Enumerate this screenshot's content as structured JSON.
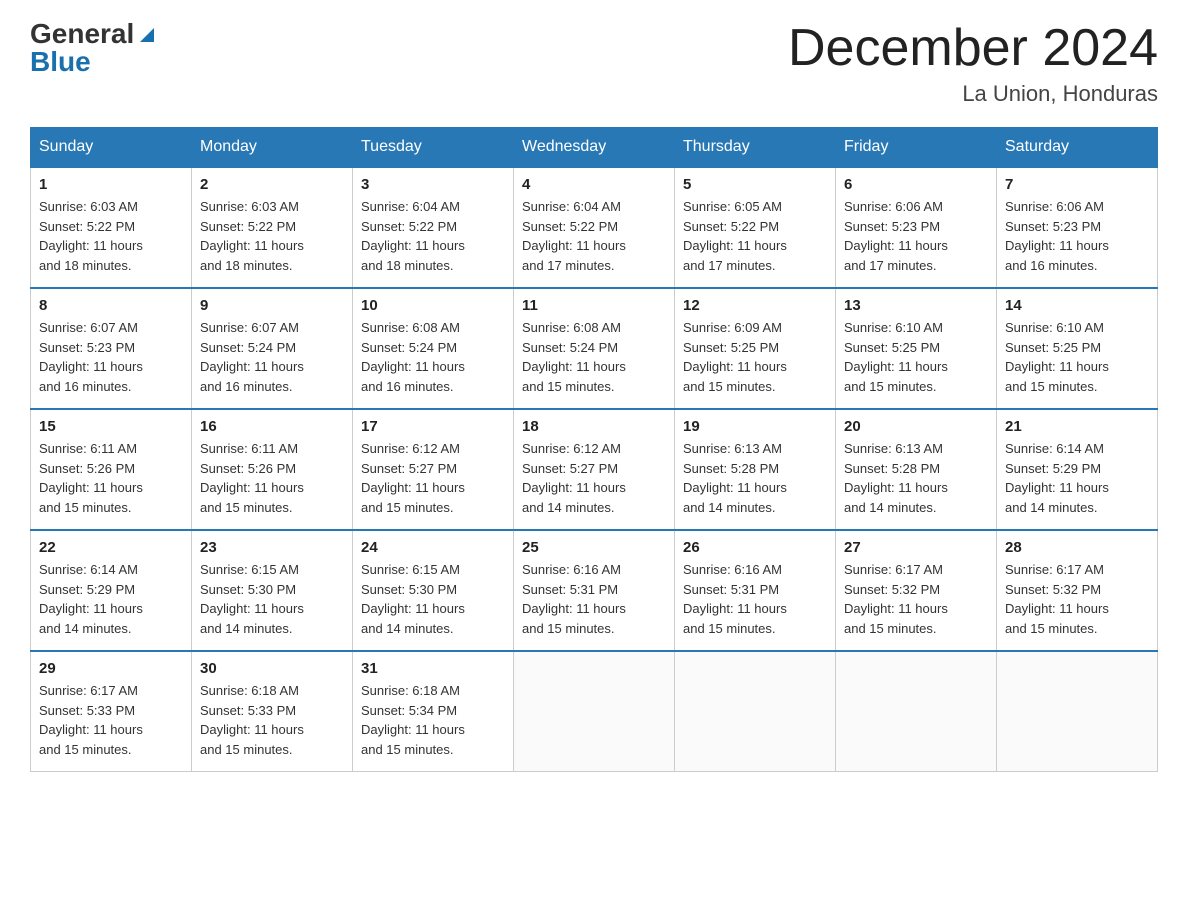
{
  "logo": {
    "general": "General",
    "blue": "Blue",
    "triangle": "▲"
  },
  "header": {
    "title": "December 2024",
    "subtitle": "La Union, Honduras"
  },
  "weekdays": [
    "Sunday",
    "Monday",
    "Tuesday",
    "Wednesday",
    "Thursday",
    "Friday",
    "Saturday"
  ],
  "weeks": [
    [
      {
        "day": "1",
        "sunrise": "6:03 AM",
        "sunset": "5:22 PM",
        "daylight": "11 hours and 18 minutes."
      },
      {
        "day": "2",
        "sunrise": "6:03 AM",
        "sunset": "5:22 PM",
        "daylight": "11 hours and 18 minutes."
      },
      {
        "day": "3",
        "sunrise": "6:04 AM",
        "sunset": "5:22 PM",
        "daylight": "11 hours and 18 minutes."
      },
      {
        "day": "4",
        "sunrise": "6:04 AM",
        "sunset": "5:22 PM",
        "daylight": "11 hours and 17 minutes."
      },
      {
        "day": "5",
        "sunrise": "6:05 AM",
        "sunset": "5:22 PM",
        "daylight": "11 hours and 17 minutes."
      },
      {
        "day": "6",
        "sunrise": "6:06 AM",
        "sunset": "5:23 PM",
        "daylight": "11 hours and 17 minutes."
      },
      {
        "day": "7",
        "sunrise": "6:06 AM",
        "sunset": "5:23 PM",
        "daylight": "11 hours and 16 minutes."
      }
    ],
    [
      {
        "day": "8",
        "sunrise": "6:07 AM",
        "sunset": "5:23 PM",
        "daylight": "11 hours and 16 minutes."
      },
      {
        "day": "9",
        "sunrise": "6:07 AM",
        "sunset": "5:24 PM",
        "daylight": "11 hours and 16 minutes."
      },
      {
        "day": "10",
        "sunrise": "6:08 AM",
        "sunset": "5:24 PM",
        "daylight": "11 hours and 16 minutes."
      },
      {
        "day": "11",
        "sunrise": "6:08 AM",
        "sunset": "5:24 PM",
        "daylight": "11 hours and 15 minutes."
      },
      {
        "day": "12",
        "sunrise": "6:09 AM",
        "sunset": "5:25 PM",
        "daylight": "11 hours and 15 minutes."
      },
      {
        "day": "13",
        "sunrise": "6:10 AM",
        "sunset": "5:25 PM",
        "daylight": "11 hours and 15 minutes."
      },
      {
        "day": "14",
        "sunrise": "6:10 AM",
        "sunset": "5:25 PM",
        "daylight": "11 hours and 15 minutes."
      }
    ],
    [
      {
        "day": "15",
        "sunrise": "6:11 AM",
        "sunset": "5:26 PM",
        "daylight": "11 hours and 15 minutes."
      },
      {
        "day": "16",
        "sunrise": "6:11 AM",
        "sunset": "5:26 PM",
        "daylight": "11 hours and 15 minutes."
      },
      {
        "day": "17",
        "sunrise": "6:12 AM",
        "sunset": "5:27 PM",
        "daylight": "11 hours and 15 minutes."
      },
      {
        "day": "18",
        "sunrise": "6:12 AM",
        "sunset": "5:27 PM",
        "daylight": "11 hours and 14 minutes."
      },
      {
        "day": "19",
        "sunrise": "6:13 AM",
        "sunset": "5:28 PM",
        "daylight": "11 hours and 14 minutes."
      },
      {
        "day": "20",
        "sunrise": "6:13 AM",
        "sunset": "5:28 PM",
        "daylight": "11 hours and 14 minutes."
      },
      {
        "day": "21",
        "sunrise": "6:14 AM",
        "sunset": "5:29 PM",
        "daylight": "11 hours and 14 minutes."
      }
    ],
    [
      {
        "day": "22",
        "sunrise": "6:14 AM",
        "sunset": "5:29 PM",
        "daylight": "11 hours and 14 minutes."
      },
      {
        "day": "23",
        "sunrise": "6:15 AM",
        "sunset": "5:30 PM",
        "daylight": "11 hours and 14 minutes."
      },
      {
        "day": "24",
        "sunrise": "6:15 AM",
        "sunset": "5:30 PM",
        "daylight": "11 hours and 14 minutes."
      },
      {
        "day": "25",
        "sunrise": "6:16 AM",
        "sunset": "5:31 PM",
        "daylight": "11 hours and 15 minutes."
      },
      {
        "day": "26",
        "sunrise": "6:16 AM",
        "sunset": "5:31 PM",
        "daylight": "11 hours and 15 minutes."
      },
      {
        "day": "27",
        "sunrise": "6:17 AM",
        "sunset": "5:32 PM",
        "daylight": "11 hours and 15 minutes."
      },
      {
        "day": "28",
        "sunrise": "6:17 AM",
        "sunset": "5:32 PM",
        "daylight": "11 hours and 15 minutes."
      }
    ],
    [
      {
        "day": "29",
        "sunrise": "6:17 AM",
        "sunset": "5:33 PM",
        "daylight": "11 hours and 15 minutes."
      },
      {
        "day": "30",
        "sunrise": "6:18 AM",
        "sunset": "5:33 PM",
        "daylight": "11 hours and 15 minutes."
      },
      {
        "day": "31",
        "sunrise": "6:18 AM",
        "sunset": "5:34 PM",
        "daylight": "11 hours and 15 minutes."
      },
      null,
      null,
      null,
      null
    ]
  ],
  "labels": {
    "sunrise": "Sunrise:",
    "sunset": "Sunset:",
    "daylight": "Daylight:"
  }
}
